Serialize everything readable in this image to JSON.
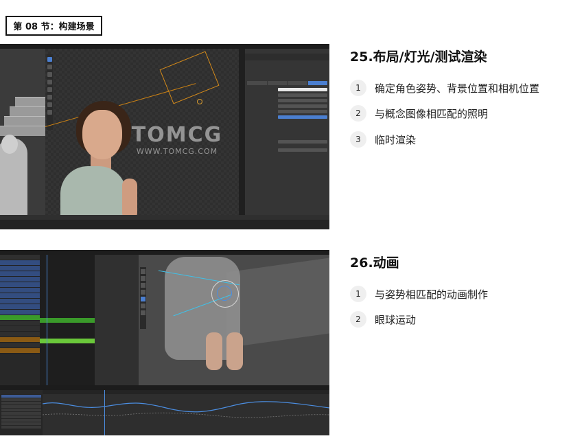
{
  "section_tag": "第 08 节：构建场景",
  "sections": [
    {
      "heading": "25.布局/灯光/测试渲染",
      "items": [
        {
          "num": "1",
          "text": "确定角色姿势、背景位置和相机位置"
        },
        {
          "num": "2",
          "text": "与概念图像相匹配的照明"
        },
        {
          "num": "3",
          "text": "临时渲染"
        }
      ]
    },
    {
      "heading": "26.动画",
      "items": [
        {
          "num": "1",
          "text": "与姿势相匹配的动画制作"
        },
        {
          "num": "2",
          "text": "眼球运动"
        }
      ]
    }
  ],
  "screenshot1": {
    "watermark_big": "TOMCG",
    "watermark_small": "WWW.TOMCG.COM"
  },
  "colors": {
    "accent_blue": "#4b7fd0",
    "light_orange": "#d48a1a",
    "keyframe_green": "#3a9a2a"
  }
}
